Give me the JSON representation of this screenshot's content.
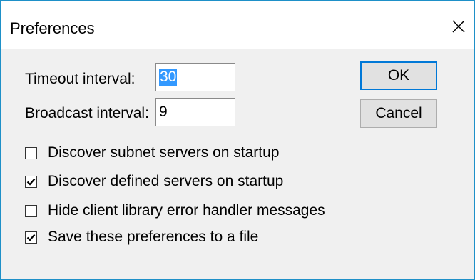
{
  "window": {
    "title": "Preferences",
    "close_icon": "close-icon"
  },
  "fields": {
    "timeout": {
      "label": "Timeout interval:",
      "value": "30"
    },
    "broadcast": {
      "label": "Broadcast interval:",
      "value": "9"
    }
  },
  "buttons": {
    "ok": "OK",
    "cancel": "Cancel"
  },
  "options": [
    {
      "label": "Discover subnet servers on startup",
      "checked": false
    },
    {
      "label": "Discover defined servers on startup",
      "checked": true
    },
    {
      "label": "Hide client library error handler messages",
      "checked": false
    },
    {
      "label": "Save these preferences to a file",
      "checked": true
    }
  ],
  "colors": {
    "accent": "#0078d7",
    "selection": "#3399ff",
    "window_border": "#1e90c8"
  }
}
